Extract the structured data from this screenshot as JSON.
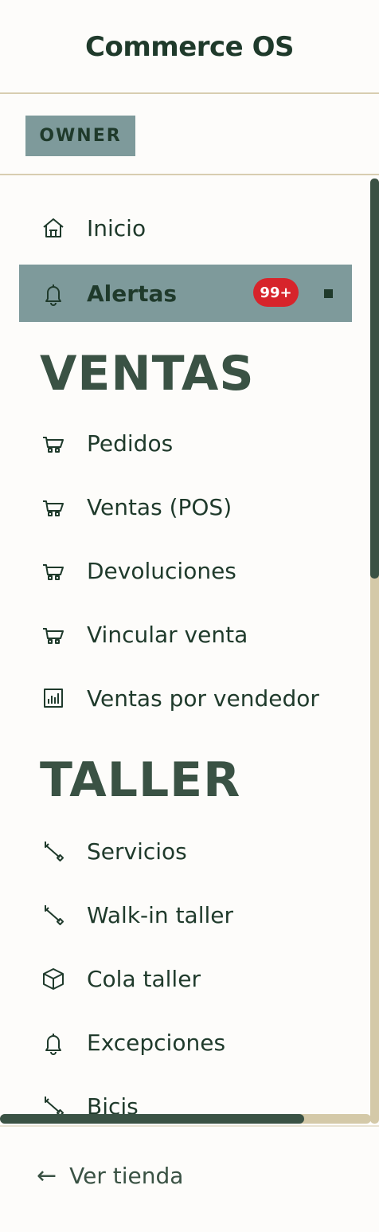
{
  "header": {
    "title": "Commerce OS"
  },
  "role": {
    "label": "OWNER"
  },
  "nav": {
    "inicio": {
      "label": "Inicio",
      "icon": "home-icon"
    },
    "alertas": {
      "label": "Alertas",
      "icon": "bell-icon",
      "badge": "99+",
      "active": true
    },
    "sections": [
      {
        "title": "VENTAS",
        "items": [
          {
            "label": "Pedidos",
            "icon": "cart-icon"
          },
          {
            "label": "Ventas (POS)",
            "icon": "cart-icon"
          },
          {
            "label": "Devoluciones",
            "icon": "cart-icon"
          },
          {
            "label": "Vincular venta",
            "icon": "cart-icon"
          },
          {
            "label": "Ventas por vendedor",
            "icon": "bar-chart-icon"
          }
        ]
      },
      {
        "title": "TALLER",
        "items": [
          {
            "label": "Servicios",
            "icon": "wrench-icon"
          },
          {
            "label": "Walk-in taller",
            "icon": "wrench-icon"
          },
          {
            "label": "Cola taller",
            "icon": "box-icon"
          },
          {
            "label": "Excepciones",
            "icon": "bell-icon"
          },
          {
            "label": "Bicis",
            "icon": "wrench-icon"
          }
        ]
      }
    ]
  },
  "footer": {
    "back_label": "Ver tienda",
    "back_arrow": "←"
  },
  "colors": {
    "accent": "#7e9a9b",
    "text": "#1f3a2b",
    "heading": "#3a5244",
    "badge": "#d7242b",
    "divider": "#d8cdb0",
    "scroll_track": "#d4c9a8"
  }
}
